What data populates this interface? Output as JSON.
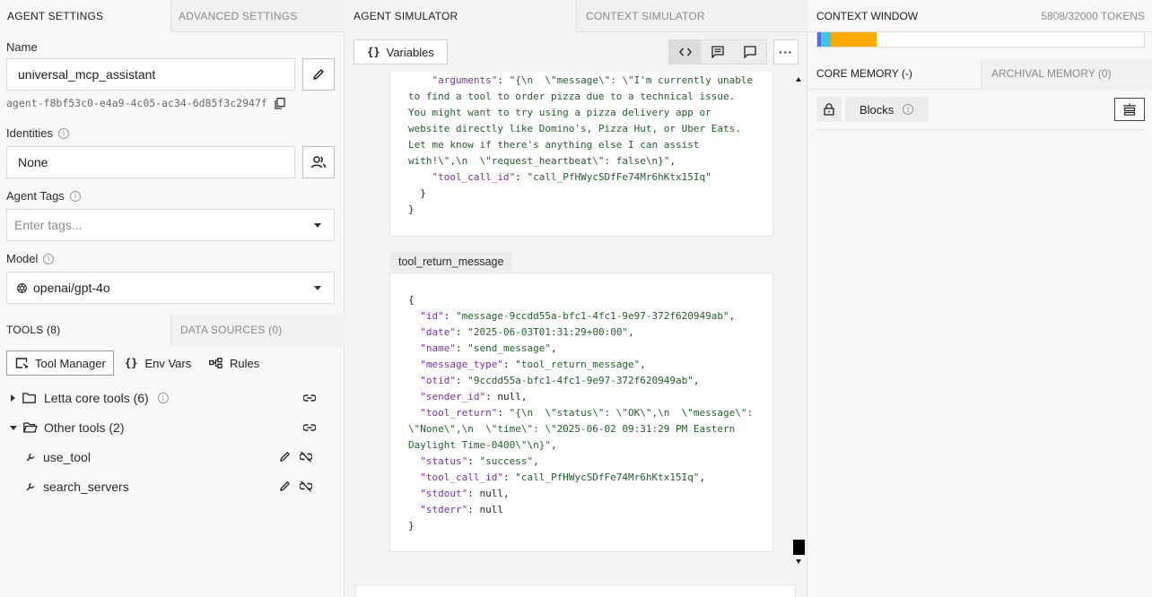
{
  "left": {
    "tabs": [
      {
        "label": "AGENT SETTINGS",
        "active": true
      },
      {
        "label": "ADVANCED SETTINGS",
        "active": false
      }
    ],
    "name": {
      "label": "Name",
      "value": "universal_mcp_assistant",
      "agent_id": "agent-f8bf53c0-e4a9-4c05-ac34-6d85f3c2947f"
    },
    "identities": {
      "label": "Identities",
      "value": "None"
    },
    "agent_tags": {
      "label": "Agent Tags",
      "placeholder": "Enter tags..."
    },
    "model": {
      "label": "Model",
      "value": "openai/gpt-4o"
    },
    "tool_tabs": [
      {
        "label": "TOOLS (8)",
        "active": true
      },
      {
        "label": "DATA SOURCES (0)",
        "active": false
      }
    ],
    "tool_buttons": {
      "tool_manager": "Tool Manager",
      "env_vars": "Env Vars",
      "rules": "Rules"
    },
    "tool_groups": [
      {
        "label": "Letta core tools (6)",
        "expanded": false
      },
      {
        "label": "Other tools (2)",
        "expanded": true
      }
    ],
    "tools": [
      {
        "label": "use_tool"
      },
      {
        "label": "search_servers"
      }
    ]
  },
  "middle": {
    "tabs": [
      {
        "label": "AGENT SIMULATOR",
        "active": true
      },
      {
        "label": "CONTEXT SIMULATOR",
        "active": false
      }
    ],
    "variables_button": "Variables",
    "message_type_label": "tool_return_message",
    "more_label": "···"
  },
  "right": {
    "tab": "CONTEXT WINDOW",
    "tokens": "5808/32000 TOKENS",
    "token_fraction": 0.1815,
    "memory_tabs": [
      {
        "label": "CORE MEMORY (-)",
        "active": true
      },
      {
        "label": "ARCHIVAL MEMORY (0)",
        "active": false
      }
    ],
    "blocks_button": "Blocks"
  },
  "colors": {
    "accent_orange": "#ffaa00",
    "accent_blue": "#4f6df5",
    "accent_cyan": "#3cc6ea",
    "key_purple": "#7b2fa8",
    "string_green": "#1f5f2a"
  }
}
